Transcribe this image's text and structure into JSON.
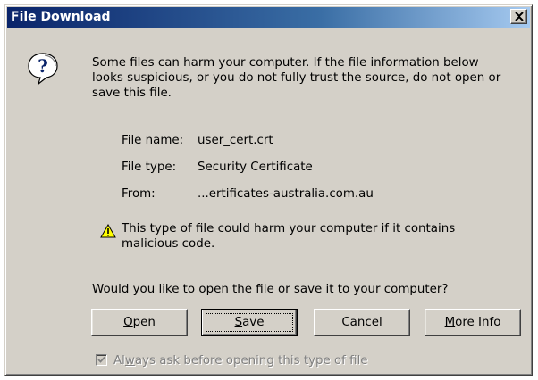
{
  "window": {
    "title": "File Download"
  },
  "message": {
    "line1": "Some files can harm your computer. If the file information below",
    "line2": "looks suspicious, or you do not fully trust the source, do not open or",
    "line3": "save this file."
  },
  "file_info": {
    "name_label": "File name:",
    "name_value": "user_cert.crt",
    "type_label": "File type:",
    "type_value": "Security Certificate",
    "from_label": "From:",
    "from_value": "...ertificates-australia.com.au"
  },
  "warning": {
    "line1": "This type of file could harm your computer if it contains",
    "line2": "malicious code."
  },
  "prompt": "Would you like to open the file or save it to your computer?",
  "buttons": {
    "open": {
      "accel": "O",
      "rest": "pen"
    },
    "save": {
      "accel": "S",
      "rest": "ave"
    },
    "cancel": "Cancel",
    "more_info": {
      "accel": "M",
      "rest": "ore Info"
    }
  },
  "checkbox": {
    "checked": true,
    "label_pre": "Al",
    "label_accel": "w",
    "label_post": "ays ask before opening this type of file"
  },
  "icons": {
    "question": "question-icon",
    "warning": "warning-icon",
    "close": "close-icon",
    "check": "checkmark-icon"
  }
}
